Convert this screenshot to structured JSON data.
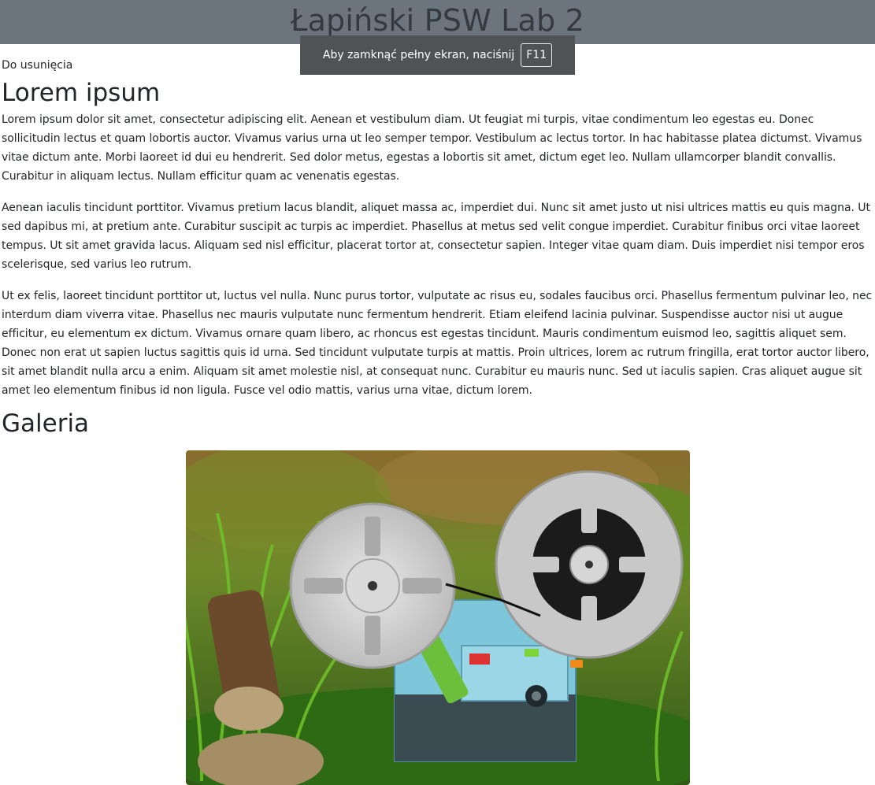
{
  "header": {
    "title": "Łapiński PSW Lab 2"
  },
  "fullscreen_notice": {
    "text": "Aby zamknąć pełny ekran, naciśnij",
    "key": "F11"
  },
  "intro_note": "Do usunięcia",
  "section1": {
    "title": "Lorem ipsum",
    "paragraphs": [
      "Lorem ipsum dolor sit amet, consectetur adipiscing elit. Aenean et vestibulum diam. Ut feugiat mi turpis, vitae condimentum leo egestas eu. Donec sollicitudin lectus et quam lobortis auctor. Vivamus varius urna ut leo semper tempor. Vestibulum ac lectus tortor. In hac habitasse platea dictumst. Vivamus vitae dictum ante. Morbi laoreet id dui eu hendrerit. Sed dolor metus, egestas a lobortis sit amet, dictum eget leo. Nullam ullamcorper blandit convallis. Curabitur in aliquam lectus. Nullam efficitur quam ac venenatis egestas.",
      "Aenean iaculis tincidunt porttitor. Vivamus pretium lacus blandit, aliquet massa ac, imperdiet dui. Nunc sit amet justo ut nisi ultrices mattis eu quis magna. Ut sed dapibus mi, at pretium ante. Curabitur suscipit ac turpis ac imperdiet. Phasellus at metus sed velit congue imperdiet. Curabitur finibus orci vitae laoreet tempus. Ut sit amet gravida lacus. Aliquam sed nisl efficitur, placerat tortor at, consectetur sapien. Integer vitae quam diam. Duis imperdiet nisi tempor eros scelerisque, sed varius leo rutrum.",
      "Ut ex felis, laoreet tincidunt porttitor ut, luctus vel nulla. Nunc purus tortor, vulputate ac risus eu, sodales faucibus orci. Phasellus fermentum pulvinar leo, nec interdum diam viverra vitae. Phasellus nec mauris vulputate nunc fermentum hendrerit. Etiam eleifend lacinia pulvinar. Suspendisse auctor nisi ut augue efficitur, eu elementum ex dictum. Vivamus ornare quam libero, ac rhoncus est egestas tincidunt. Mauris condimentum euismod leo, sagittis aliquet sem. Donec non erat ut sapien luctus sagittis quis id urna. Sed tincidunt vulputate turpis at mattis. Proin ultrices, lorem ac rutrum fringilla, erat tortor auctor libero, sit amet blandit nulla arcu a enim. Aliquam sit amet molestie nisl, at consequat nunc. Curabitur eu mauris nunc. Sed ut iaculis sapien. Cras aliquet augue sit amet leo elementum finibus id non ligula. Fusce vel odio mattis, varius urna vitae, dictum lorem."
    ]
  },
  "gallery": {
    "title": "Galeria",
    "image_icon": "film-projector-photo"
  },
  "colors": {
    "header_bg": "#6c757d",
    "toast_bg": "#4f5356",
    "text": "#212529"
  }
}
